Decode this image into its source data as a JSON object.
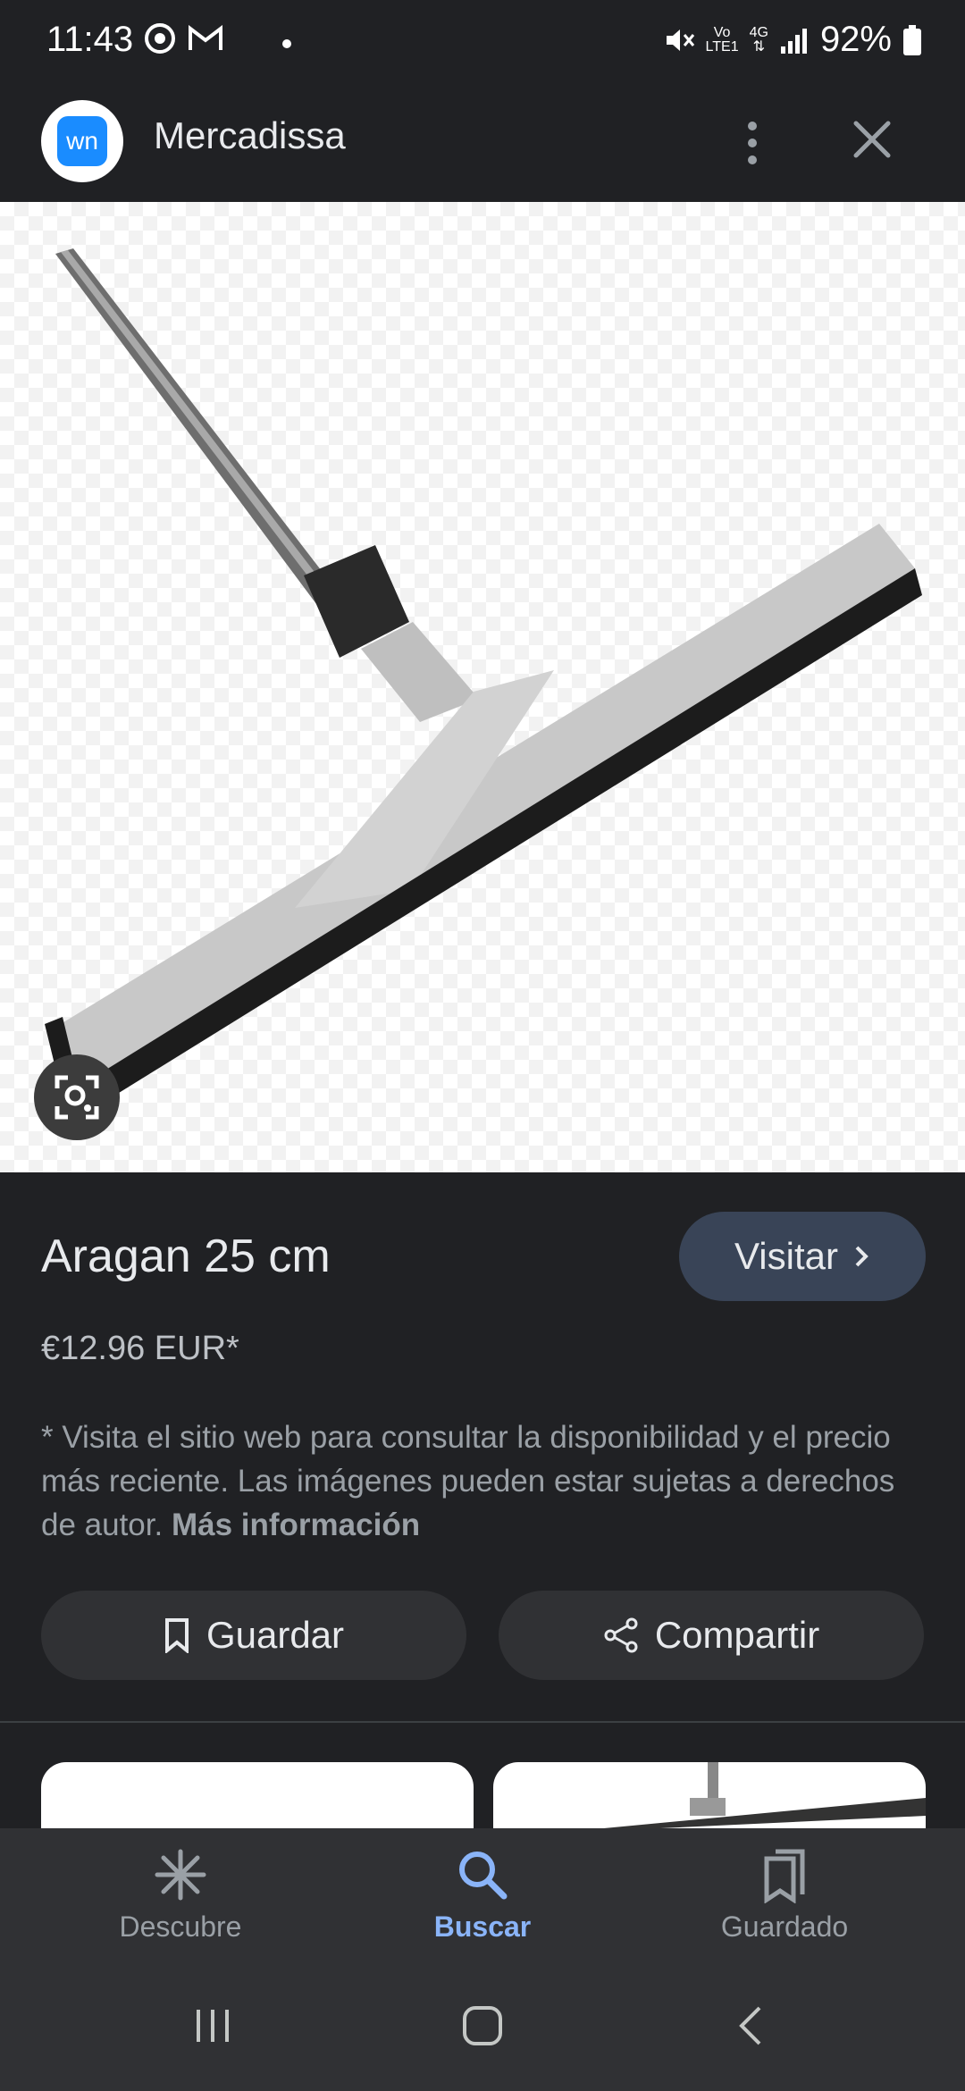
{
  "status_bar": {
    "time": "11:43",
    "battery": "92%",
    "network_small_top": "Vo",
    "network_small_bottom": "LTE1",
    "network_type": "4G"
  },
  "header": {
    "logo_text": "wn",
    "site_name": "Mercadissa"
  },
  "product": {
    "title": "Aragan 25 cm",
    "price": "€12.96 EUR*",
    "visit_label": "Visitar",
    "disclaimer": "* Visita el sitio web para consultar la disponibilidad y el precio más reciente. Las imágenes pueden estar sujetas a derechos de autor.",
    "more_info_label": "Más información",
    "save_label": "Guardar",
    "share_label": "Compartir"
  },
  "bottom_nav": {
    "items": [
      {
        "label": "Descubre",
        "icon": "asterisk-icon",
        "active": false
      },
      {
        "label": "Buscar",
        "icon": "search-icon",
        "active": true
      },
      {
        "label": "Guardado",
        "icon": "bookmarks-icon",
        "active": false
      }
    ]
  },
  "colors": {
    "background": "#202124",
    "accent": "#8ab4f8",
    "visit_button": "#394457"
  }
}
